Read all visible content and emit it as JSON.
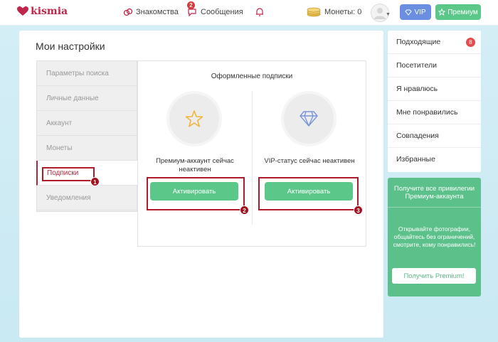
{
  "header": {
    "logo_text": "kismia",
    "nav": {
      "dating": "Знакомства",
      "messages": "Сообщения",
      "messages_badge": "2",
      "coins": "Монеты: 0"
    },
    "vip_label": "VIP",
    "premium_label": "Премиум"
  },
  "settings": {
    "title": "Мои настройки",
    "menu": [
      {
        "label": "Параметры поиска"
      },
      {
        "label": "Личные данные"
      },
      {
        "label": "Аккаунт"
      },
      {
        "label": "Монеты"
      },
      {
        "label": "Подписки"
      },
      {
        "label": "Уведомления"
      }
    ],
    "active_menu": "Подписки",
    "panel": {
      "title": "Оформленные подписки",
      "premium_status": "Премиум-аккаунт сейчас неактивен",
      "vip_status": "VIP-статус сейчас неактивен",
      "activate_label": "Активировать"
    }
  },
  "annotations": [
    "1",
    "2",
    "3"
  ],
  "sidebar": {
    "items": [
      {
        "label": "Подходящие",
        "badge": "8"
      },
      {
        "label": "Посетители"
      },
      {
        "label": "Я нравлюсь"
      },
      {
        "label": "Мне понравились"
      },
      {
        "label": "Совпадения"
      },
      {
        "label": "Избранные"
      }
    ],
    "promo": {
      "heading": "Получите все привилегии Премиум-аккаунта",
      "body": "Открывайте фотографии, общайтесь без ограничений, смотрите, кому понравились!",
      "button": "Получить Premium!"
    }
  },
  "colors": {
    "brand": "#c0264a",
    "accent_green": "#5bc88a",
    "vip_blue": "#6a8fe0",
    "annotation_red": "#b11a2a"
  }
}
